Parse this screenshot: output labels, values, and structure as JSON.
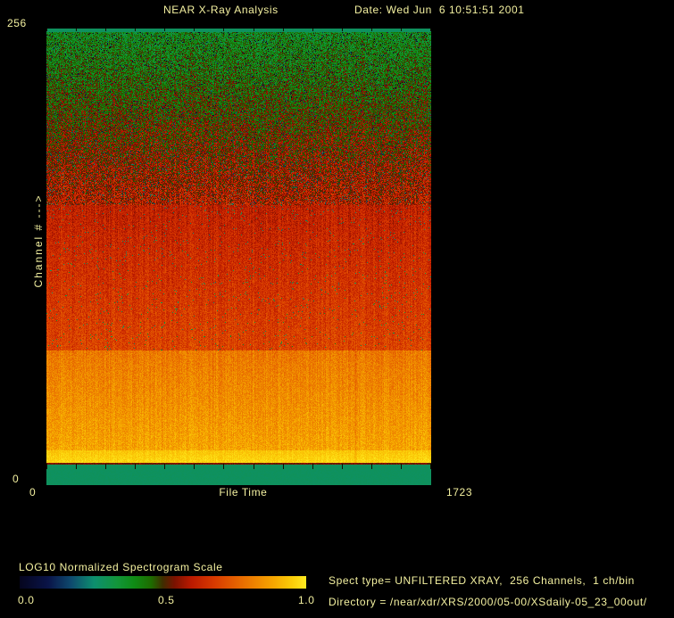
{
  "header": {
    "title": "NEAR X-Ray Analysis",
    "date_label": "Date: Wed Jun  6 10:51:51 2001"
  },
  "plot": {
    "y_axis": {
      "label": "Channel # --->",
      "max_label": "256",
      "min_label": "0"
    },
    "x_axis": {
      "label": "File Time",
      "min_label": "0",
      "max_label": "1723"
    }
  },
  "colorbar": {
    "title": "LOG10 Normalized Spectrogram Scale",
    "ticks": [
      "0.0",
      "0.5",
      "1.0"
    ]
  },
  "info": {
    "line1": "Spect type= UNFILTERED XRAY,  256 Channels,  1 ch/bin",
    "line2": "Directory = /near/xdr/XRS/2000/05-00/XSdaily-05_23_00out/"
  },
  "colors": {
    "background": "#000000",
    "text": "#F4F1A0",
    "teal_strip": "#0E8D62",
    "tick_dark": "#141000"
  },
  "chart_data": {
    "type": "heatmap",
    "title": "NEAR X-Ray Analysis",
    "xlabel": "File Time",
    "x_range": [
      0,
      1723
    ],
    "ylabel": "Channel #",
    "y_range": [
      0,
      256
    ],
    "scale_label": "LOG10 Normalized Spectrogram Scale",
    "scale_range": [
      0.0,
      1.0
    ],
    "legend_position": "bottom-left",
    "colormap_stops": [
      [
        0.0,
        "#05051E"
      ],
      [
        0.1,
        "#0A1448"
      ],
      [
        0.18,
        "#0E4A6E"
      ],
      [
        0.26,
        "#0D8F6E"
      ],
      [
        0.34,
        "#12953A"
      ],
      [
        0.4,
        "#0F8C14"
      ],
      [
        0.46,
        "#1E6B00"
      ],
      [
        0.5,
        "#402D00"
      ],
      [
        0.54,
        "#7A1200"
      ],
      [
        0.6,
        "#BB1A00"
      ],
      [
        0.68,
        "#D83A00"
      ],
      [
        0.78,
        "#E96E00"
      ],
      [
        0.88,
        "#F5A300"
      ],
      [
        0.95,
        "#FBCC08"
      ],
      [
        1.0,
        "#FFEA20"
      ]
    ],
    "bands": [
      {
        "name": "bottom-solid-teal-strip",
        "ch": [
          0,
          11.5
        ],
        "v": [
          0.285,
          0.285
        ],
        "noise": 0.006,
        "speckle_p": 0,
        "speckle_dv": 0
      },
      {
        "name": "dark-separator-line",
        "ch": [
          11.5,
          12.8
        ],
        "v": [
          0.54,
          0.54
        ],
        "noise": 0.03,
        "speckle_p": 0,
        "speckle_dv": 0
      },
      {
        "name": "bright-yellow-row",
        "ch": [
          12.8,
          19.5
        ],
        "v": [
          0.97,
          0.94
        ],
        "noise": 0.025,
        "speckle_p": 0,
        "speckle_dv": 0
      },
      {
        "name": "orange-amber-band",
        "ch": [
          19.5,
          75.5
        ],
        "v": [
          0.885,
          0.8
        ],
        "noise": 0.045,
        "speckle_p": 0,
        "speckle_dv": 0
      },
      {
        "name": "red-region",
        "ch": [
          75.5,
          157
        ],
        "v": [
          0.7,
          0.615
        ],
        "noise": 0.05,
        "speckle_p": 0.015,
        "speckle_dv": -0.35
      },
      {
        "name": "green-red-mottled-region",
        "ch": [
          157,
          254
        ],
        "v": [
          0.6,
          0.4
        ],
        "noise": 0.1,
        "speckle_p": 0.05,
        "speckle_dv": -0.35
      },
      {
        "name": "top-solid-teal-strip",
        "ch": [
          254,
          256
        ],
        "v": [
          0.285,
          0.285
        ],
        "noise": 0.006,
        "speckle_p": 0,
        "speckle_dv": 0
      }
    ],
    "vertical_feature": {
      "x_frac": 0.803,
      "ch_range": [
        12.5,
        76
      ],
      "dv": -0.035,
      "description": "faint dark vertical line in orange band"
    },
    "x_tick_intervals": 13
  }
}
